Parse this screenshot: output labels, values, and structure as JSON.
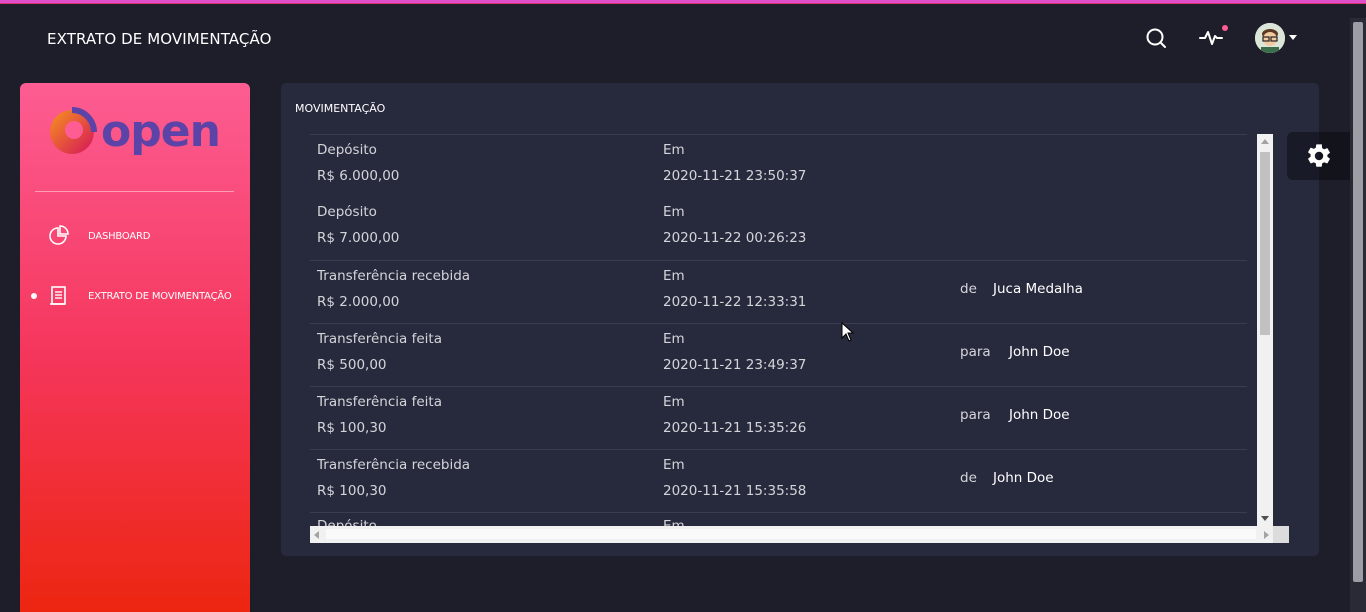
{
  "header": {
    "title": "EXTRATO DE MOVIMENTAÇÃO"
  },
  "icons": {
    "search": "search-icon",
    "activity": "activity-icon",
    "avatar": "avatar",
    "caret": "caret-down-icon",
    "settings": "gear-icon"
  },
  "colors": {
    "accent": "#e14eca",
    "sidebar_top": "#fd5d93",
    "sidebar_bottom": "#ec250d",
    "card_bg": "#27293d",
    "page_bg": "#1e1e2b",
    "logo": "#5b43a8"
  },
  "sidebar": {
    "logo_text": "open",
    "items": [
      {
        "label": "DASHBOARD",
        "icon": "chart-pie-icon",
        "active": false
      },
      {
        "label": "EXTRATO DE MOVIMENTAÇÃO",
        "icon": "document-icon",
        "active": true
      }
    ]
  },
  "main": {
    "card_title": "MOVIMENTAÇÃO",
    "rows": [
      {
        "type": "Depósito",
        "amount": "R$ 6.000,00",
        "date_label": "Em",
        "date": "2020-11-21 23:50:37",
        "party_prefix": "",
        "party": ""
      },
      {
        "type": "Depósito",
        "amount": "R$ 7.000,00",
        "date_label": "Em",
        "date": "2020-11-22 00:26:23",
        "party_prefix": "",
        "party": ""
      },
      {
        "type": "Transferência recebida",
        "amount": "R$ 2.000,00",
        "date_label": "Em",
        "date": "2020-11-22 12:33:31",
        "party_prefix": "de",
        "party": "Juca Medalha"
      },
      {
        "type": "Transferência feita",
        "amount": "R$ 500,00",
        "date_label": "Em",
        "date": "2020-11-21 23:49:37",
        "party_prefix": "para",
        "party": "John Doe"
      },
      {
        "type": "Transferência feita",
        "amount": "R$ 100,30",
        "date_label": "Em",
        "date": "2020-11-21 15:35:26",
        "party_prefix": "para",
        "party": "John Doe"
      },
      {
        "type": "Transferência recebida",
        "amount": "R$ 100,30",
        "date_label": "Em",
        "date": "2020-11-21 15:35:58",
        "party_prefix": "de",
        "party": "John Doe"
      },
      {
        "type": "Depósito",
        "amount": "",
        "date_label": "Em",
        "date": "",
        "party_prefix": "",
        "party": ""
      }
    ]
  }
}
